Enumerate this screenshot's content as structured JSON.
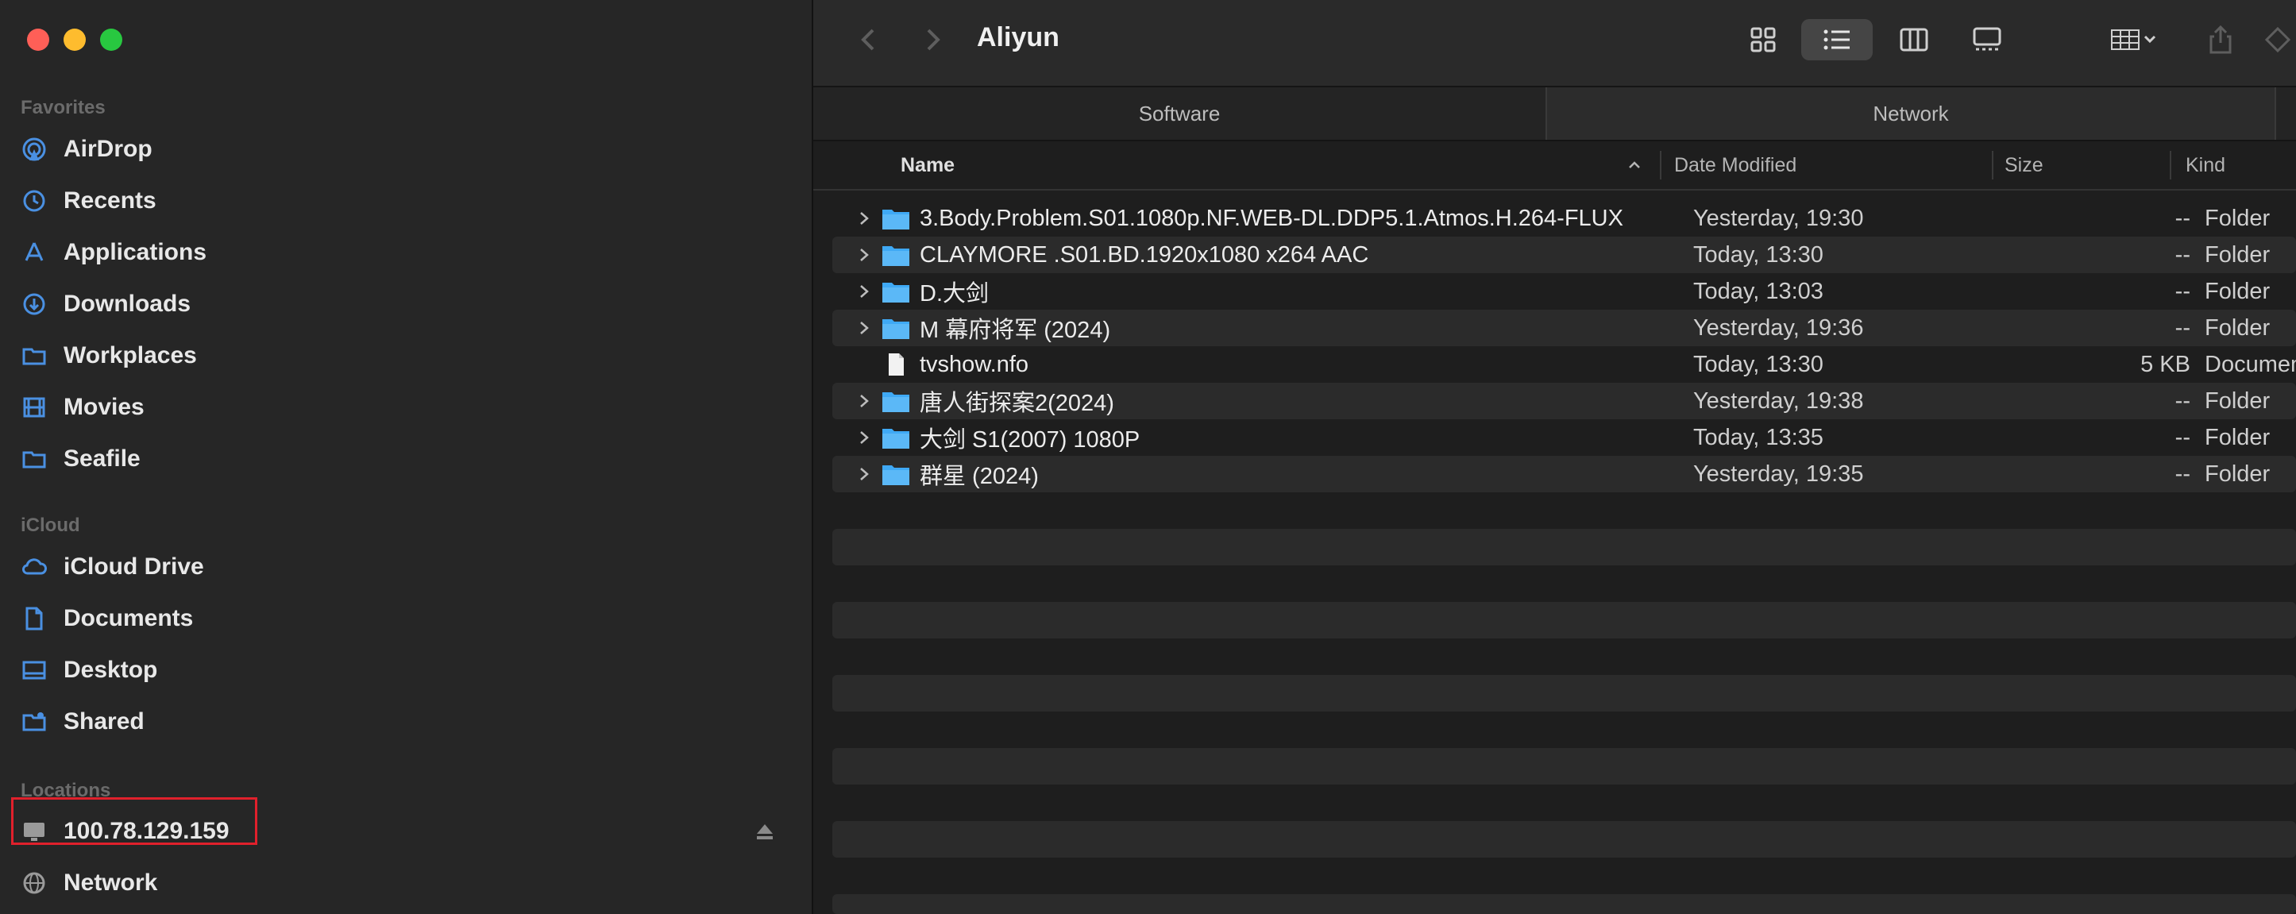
{
  "window": {
    "title": "Aliyun"
  },
  "sidebar": {
    "favorites_title": "Favorites",
    "favorites": [
      {
        "label": "AirDrop",
        "icon": "airdrop-icon"
      },
      {
        "label": "Recents",
        "icon": "clock-icon"
      },
      {
        "label": "Applications",
        "icon": "applications-icon"
      },
      {
        "label": "Downloads",
        "icon": "download-icon"
      },
      {
        "label": "Workplaces",
        "icon": "folder-icon"
      },
      {
        "label": "Movies",
        "icon": "film-icon"
      },
      {
        "label": "Seafile",
        "icon": "folder-icon"
      }
    ],
    "icloud_title": "iCloud",
    "icloud": [
      {
        "label": "iCloud Drive",
        "icon": "cloud-icon"
      },
      {
        "label": "Documents",
        "icon": "document-icon"
      },
      {
        "label": "Desktop",
        "icon": "desktop-icon"
      },
      {
        "label": "Shared",
        "icon": "shared-folder-icon"
      }
    ],
    "locations_title": "Locations",
    "locations": [
      {
        "label": "100.78.129.159",
        "icon": "monitor-icon"
      },
      {
        "label": "Network",
        "icon": "globe-icon"
      }
    ]
  },
  "tabs": [
    {
      "label": "Software"
    },
    {
      "label": "Network"
    }
  ],
  "columns": {
    "name": "Name",
    "date": "Date Modified",
    "size": "Size",
    "kind": "Kind"
  },
  "files": [
    {
      "name": "3.Body.Problem.S01.1080p.NF.WEB-DL.DDP5.1.Atmos.H.264-FLUX",
      "date": "Yesterday, 19:30",
      "size": "--",
      "kind": "Folder",
      "type": "folder"
    },
    {
      "name": "CLAYMORE .S01.BD.1920x1080 x264 AAC",
      "date": "Today, 13:30",
      "size": "--",
      "kind": "Folder",
      "type": "folder"
    },
    {
      "name": "D.大剑",
      "date": "Today, 13:03",
      "size": "--",
      "kind": "Folder",
      "type": "folder"
    },
    {
      "name": "M 幕府将军 (2024)",
      "date": "Yesterday, 19:36",
      "size": "--",
      "kind": "Folder",
      "type": "folder"
    },
    {
      "name": "tvshow.nfo",
      "date": "Today, 13:30",
      "size": "5 KB",
      "kind": "Document",
      "type": "file"
    },
    {
      "name": "唐人街探案2(2024)",
      "date": "Yesterday, 19:38",
      "size": "--",
      "kind": "Folder",
      "type": "folder"
    },
    {
      "name": "大剑 S1(2007) 1080P",
      "date": "Today, 13:35",
      "size": "--",
      "kind": "Folder",
      "type": "folder"
    },
    {
      "name": "群星 (2024)",
      "date": "Yesterday, 19:35",
      "size": "--",
      "kind": "Folder",
      "type": "folder"
    }
  ],
  "colors": {
    "folder": "#3fa9f5",
    "highlight": "#e0202c",
    "sidebar_bg": "#262626"
  }
}
